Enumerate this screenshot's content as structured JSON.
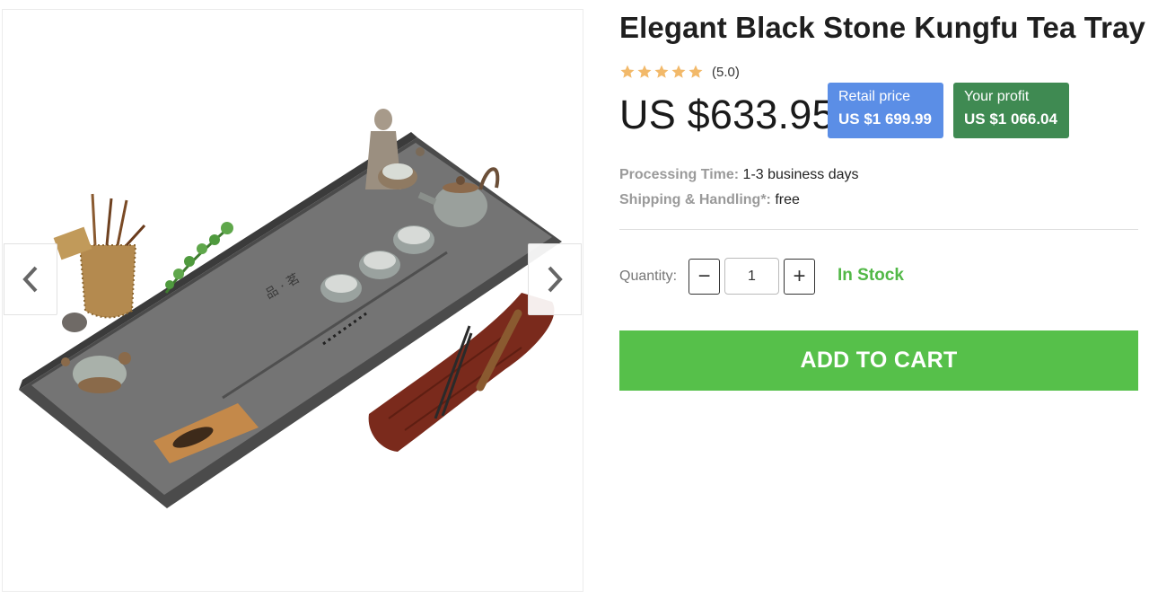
{
  "product": {
    "title": "Elegant Black Stone Kungfu Tea Tray",
    "rating": {
      "stars": 5,
      "max_stars": 5,
      "value_text": "(5.0)",
      "star_color": "#f2b96a"
    },
    "price": "US $633.95",
    "retail": {
      "label": "Retail price",
      "value": "US $1 699.99",
      "color": "#5b8ee6"
    },
    "profit": {
      "label": "Your profit",
      "value": "US $1 066.04",
      "color": "#3f8a52"
    },
    "processing": {
      "label": "Processing Time:",
      "value": "1-3 business days"
    },
    "shipping": {
      "label": "Shipping & Handling*:",
      "value": "free"
    }
  },
  "gallery": {
    "prev_icon": "chevron-left-icon",
    "next_icon": "chevron-right-icon"
  },
  "purchase": {
    "quantity_label": "Quantity:",
    "quantity_value": "1",
    "minus_symbol": "−",
    "plus_symbol": "+",
    "stock_status": "In Stock",
    "stock_color": "#52b847",
    "add_to_cart": "ADD TO CART",
    "add_to_cart_color": "#56c04a"
  }
}
